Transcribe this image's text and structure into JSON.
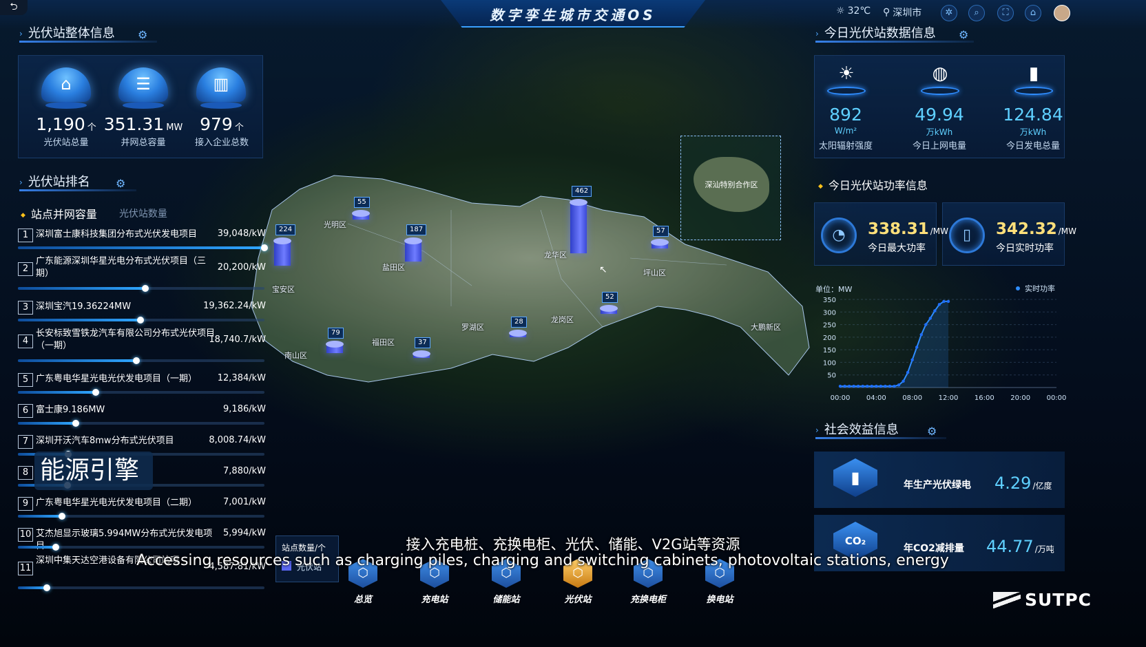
{
  "header": {
    "title": "数字孪生城市交通OS",
    "back": "⮌",
    "temperature": "32℃",
    "city": "深圳市"
  },
  "overview": {
    "title": "光伏站整体信息",
    "stats": [
      {
        "value": "1,190",
        "unit": "个",
        "label": "光伏站总量",
        "icon": "home-icon"
      },
      {
        "value": "351.31",
        "unit": "MW",
        "label": "并网总容量",
        "icon": "server-icon"
      },
      {
        "value": "979",
        "unit": "个",
        "label": "接入企业总数",
        "icon": "building-icon"
      }
    ]
  },
  "ranking": {
    "title": "光伏站排名",
    "tab_active": "站点并网容量",
    "tab_inactive": "光伏站数量",
    "rows": [
      {
        "rank": "1",
        "name": "深圳富士康科技集团分布式光伏发电项目",
        "value": "39,048/kW",
        "fraction": 1.0
      },
      {
        "rank": "2",
        "name": "广东能源深圳华星光电分布式光伏项目（三期）",
        "value": "20,200/kW",
        "fraction": 0.517
      },
      {
        "rank": "3",
        "name": "深圳宝汽19.36224MW",
        "value": "19,362.24/kW",
        "fraction": 0.496
      },
      {
        "rank": "4",
        "name": "长安标致雪铁龙汽车有限公司分布式光伏项目（一期）",
        "value": "18,740.7/kW",
        "fraction": 0.48
      },
      {
        "rank": "5",
        "name": "广东粤电华星光电光伏发电项目（一期）",
        "value": "12,384/kW",
        "fraction": 0.317
      },
      {
        "rank": "6",
        "name": "富士康9.186MW",
        "value": "9,186/kW",
        "fraction": 0.235
      },
      {
        "rank": "7",
        "name": "深圳开沃汽车8mw分布式光伏项目",
        "value": "8,008.74/kW",
        "fraction": 0.205
      },
      {
        "rank": "8",
        "name": "",
        "value": "7,880/kW",
        "fraction": 0.202
      },
      {
        "rank": "9",
        "name": "广东粤电华星光电光伏发电项目（二期）",
        "value": "7,001/kW",
        "fraction": 0.179
      },
      {
        "rank": "10",
        "name": "艾杰旭显示玻璃5.994MW分布式光伏发电项目",
        "value": "5,994/kW",
        "fraction": 0.153
      },
      {
        "rank": "11",
        "name": "深圳中集天达空港设备有限公司站项",
        "value": "4,587.81/kW",
        "fraction": 0.117
      }
    ]
  },
  "watermark": "能源引擎",
  "map": {
    "bars": [
      {
        "label": "55",
        "value": 55
      },
      {
        "label": "224",
        "value": 224
      },
      {
        "label": "187",
        "value": 187
      },
      {
        "label": "462",
        "value": 462
      },
      {
        "label": "57",
        "value": 57
      },
      {
        "label": "52",
        "value": 52
      },
      {
        "label": "28",
        "value": 28
      },
      {
        "label": "79",
        "value": 79
      },
      {
        "label": "37",
        "value": 37
      }
    ],
    "districts": [
      "光明区",
      "龙华区",
      "宝安区",
      "龙岗区",
      "坪山区",
      "福田区",
      "南山区",
      "罗湖区",
      "盐田区",
      "大鹏新区"
    ],
    "zone": "深汕特别合作区",
    "legend_title": "站点数量/个",
    "legend_item": "光伏站"
  },
  "today": {
    "title": "今日光伏站数据信息",
    "stats": [
      {
        "value": "892",
        "unit": "W/m²",
        "label": "太阳辐射强度",
        "icon": "sun-icon"
      },
      {
        "value": "49.94",
        "unit": "万kWh",
        "label": "今日上网电量",
        "icon": "globe-icon"
      },
      {
        "value": "124.84",
        "unit": "万kWh",
        "label": "今日发电总量",
        "icon": "battery-icon"
      }
    ]
  },
  "power": {
    "title": "今日光伏站功率信息",
    "max": {
      "value": "338.31",
      "unit": "/MW",
      "label": "今日最大功率"
    },
    "real": {
      "value": "342.32",
      "unit": "/MW",
      "label": "今日实时功率"
    }
  },
  "chart_data": {
    "type": "line",
    "ylabel": "单位：MW",
    "legend": "实时功率",
    "x_ticks": [
      "00:00",
      "04:00",
      "08:00",
      "12:00",
      "16:00",
      "20:00",
      "00:00"
    ],
    "y_ticks": [
      50,
      100,
      150,
      200,
      250,
      300,
      350
    ],
    "ylim": [
      0,
      350
    ],
    "series": [
      {
        "name": "实时功率",
        "x": [
          0,
          0.5,
          1,
          1.5,
          2,
          2.5,
          3,
          3.5,
          4,
          4.5,
          5,
          5.5,
          6,
          6.5,
          7,
          7.5,
          8,
          8.5,
          9,
          9.5,
          10,
          10.5,
          11,
          11.5,
          12
        ],
        "y": [
          5,
          5,
          5,
          5,
          5,
          5,
          5,
          5,
          5,
          5,
          5,
          5,
          5,
          10,
          25,
          60,
          110,
          160,
          210,
          250,
          275,
          305,
          330,
          342,
          342
        ]
      }
    ]
  },
  "social": {
    "title": "社会效益信息",
    "items": [
      {
        "label": "年生产光伏绿电",
        "value": "4.29",
        "unit": "/亿度",
        "icon": "battery-cube-icon"
      },
      {
        "label": "年CO2减排量",
        "value": "44.77",
        "unit": "/万吨",
        "icon": "co2-icon"
      }
    ]
  },
  "nav": [
    {
      "label": "总览",
      "icon": "home-icon"
    },
    {
      "label": "充电站",
      "icon": "charger-icon"
    },
    {
      "label": "储能站",
      "icon": "storage-icon"
    },
    {
      "label": "光伏站",
      "icon": "solar-icon",
      "active": true
    },
    {
      "label": "充换电柜",
      "icon": "cabinet-icon"
    },
    {
      "label": "换电站",
      "icon": "swap-icon"
    }
  ],
  "subtitles": {
    "cn": "接入充电桩、充换电柜、光伏、储能、V2G站等资源",
    "en": "Accessing resources such as charging piles, charging and switching cabinets, photovoltaic stations, energy"
  },
  "brand": "SUTPC",
  "colors": {
    "accent": "#2f8dff",
    "highlight": "#ffe07a",
    "value": "#5fd0ff",
    "bar": "#5a66f0"
  }
}
